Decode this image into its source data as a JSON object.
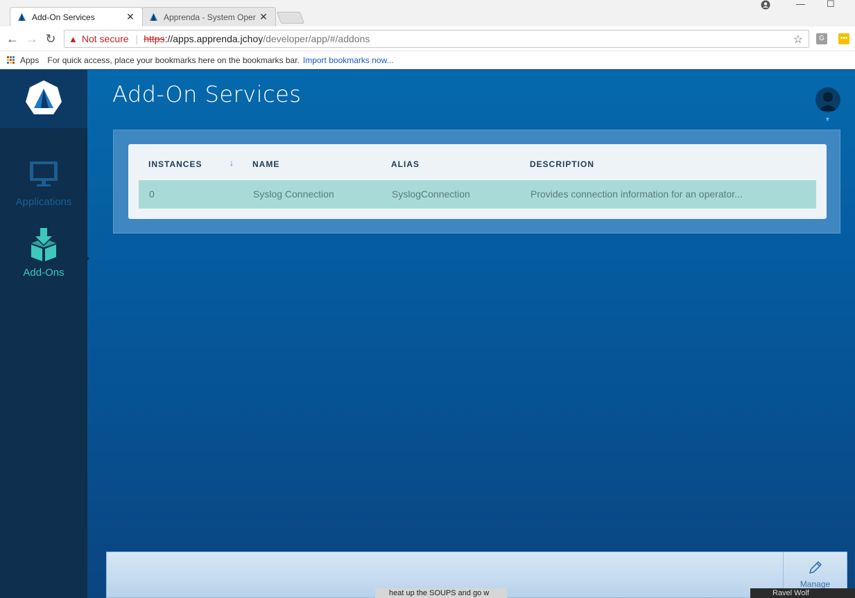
{
  "browser": {
    "tabs": [
      {
        "label": "Add-On Services",
        "active": true
      },
      {
        "label": "Apprenda - System Oper",
        "active": false
      }
    ],
    "close_glyph": "✕",
    "window_controls": {
      "minimize": "—",
      "maximize": "☐"
    },
    "address_bar": {
      "security_warning": "Not secure",
      "url_scheme": "https",
      "url_host": "://apps.apprenda.jchoy",
      "url_path": "/developer/app/#/addons"
    },
    "bookmarks_bar": {
      "apps_label": "Apps",
      "hint": "For quick access, place your bookmarks here on the bookmarks bar.",
      "import_link": "Import bookmarks now..."
    },
    "extensions": [
      {
        "name": "g-extension-icon",
        "glyph": "G",
        "color": "#9e9e9e"
      },
      {
        "name": "dots-extension-icon",
        "glyph": "•••",
        "color": "#f2c200"
      }
    ]
  },
  "sidebar": {
    "items": [
      {
        "label": "Applications",
        "icon": "monitor-icon",
        "active": false
      },
      {
        "label": "Add-Ons",
        "icon": "box-download-icon",
        "active": true
      }
    ]
  },
  "main": {
    "title": "Add-On Services",
    "table": {
      "columns": [
        "INSTANCES",
        "NAME",
        "ALIAS",
        "DESCRIPTION"
      ],
      "sort_column": "INSTANCES",
      "sort_direction": "desc",
      "rows": [
        {
          "instances": "0",
          "name": "Syslog Connection",
          "alias": "SyslogConnection",
          "description": "Provides connection information for an operator..."
        }
      ]
    }
  },
  "footer": {
    "manage_label": "Manage"
  },
  "taskbar": {
    "snippet": "heat up the SOUPS and go w",
    "right_snippet": "Ravel Wolf"
  },
  "colors": {
    "accent_teal": "#3fc7be",
    "app_blue": "#0669ad",
    "sidebar_dark": "#0e2f4e",
    "row_highlight": "#a8dbd8"
  }
}
